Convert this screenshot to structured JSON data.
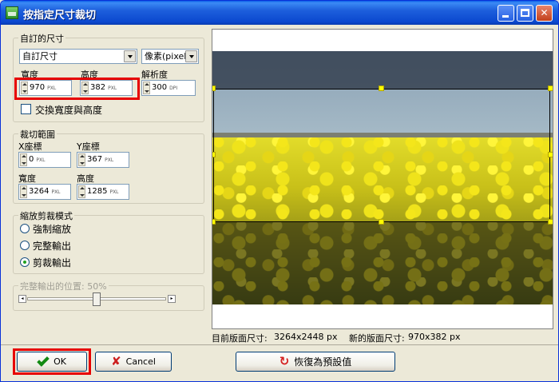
{
  "window": {
    "title": "按指定尺寸裁切"
  },
  "size_group": {
    "title": "自訂的尺寸",
    "preset_value": "自訂尺寸",
    "unit_value": "像素(pixel)",
    "width_label": "寬度",
    "height_label": "高度",
    "resolution_label": "解析度",
    "width_value": "970",
    "width_unit": "PXL",
    "height_value": "382",
    "height_unit": "PXL",
    "resolution_value": "300",
    "resolution_unit": "DPI",
    "swap_label": "交換寬度與高度",
    "swap_checked": false
  },
  "crop_range": {
    "title": "裁切範圍",
    "x_label": "X座標",
    "y_label": "Y座標",
    "x_value": "0",
    "y_value": "367",
    "w_label": "寬度",
    "h_label": "高度",
    "w_value": "3264",
    "h_value": "1285",
    "unit": "PXL"
  },
  "scale_mode": {
    "title": "縮放剪裁模式",
    "options": [
      "強制縮放",
      "完整輸出",
      "剪裁輸出"
    ],
    "selected": "剪裁輸出"
  },
  "position": {
    "label": "完整輸出的位置: 50%",
    "value_percent": 50,
    "enabled": false
  },
  "status": {
    "current_label": "目前版面尺寸:",
    "current_value": "3264x2448 px",
    "new_label": "新的版面尺寸:",
    "new_value": "970x382 px"
  },
  "buttons": {
    "ok": "OK",
    "cancel": "Cancel",
    "reset": "恢復為預設值"
  },
  "colors": {
    "highlight": "#e60000",
    "handle": "#ffff00",
    "titlebar": "#0b48cf"
  }
}
